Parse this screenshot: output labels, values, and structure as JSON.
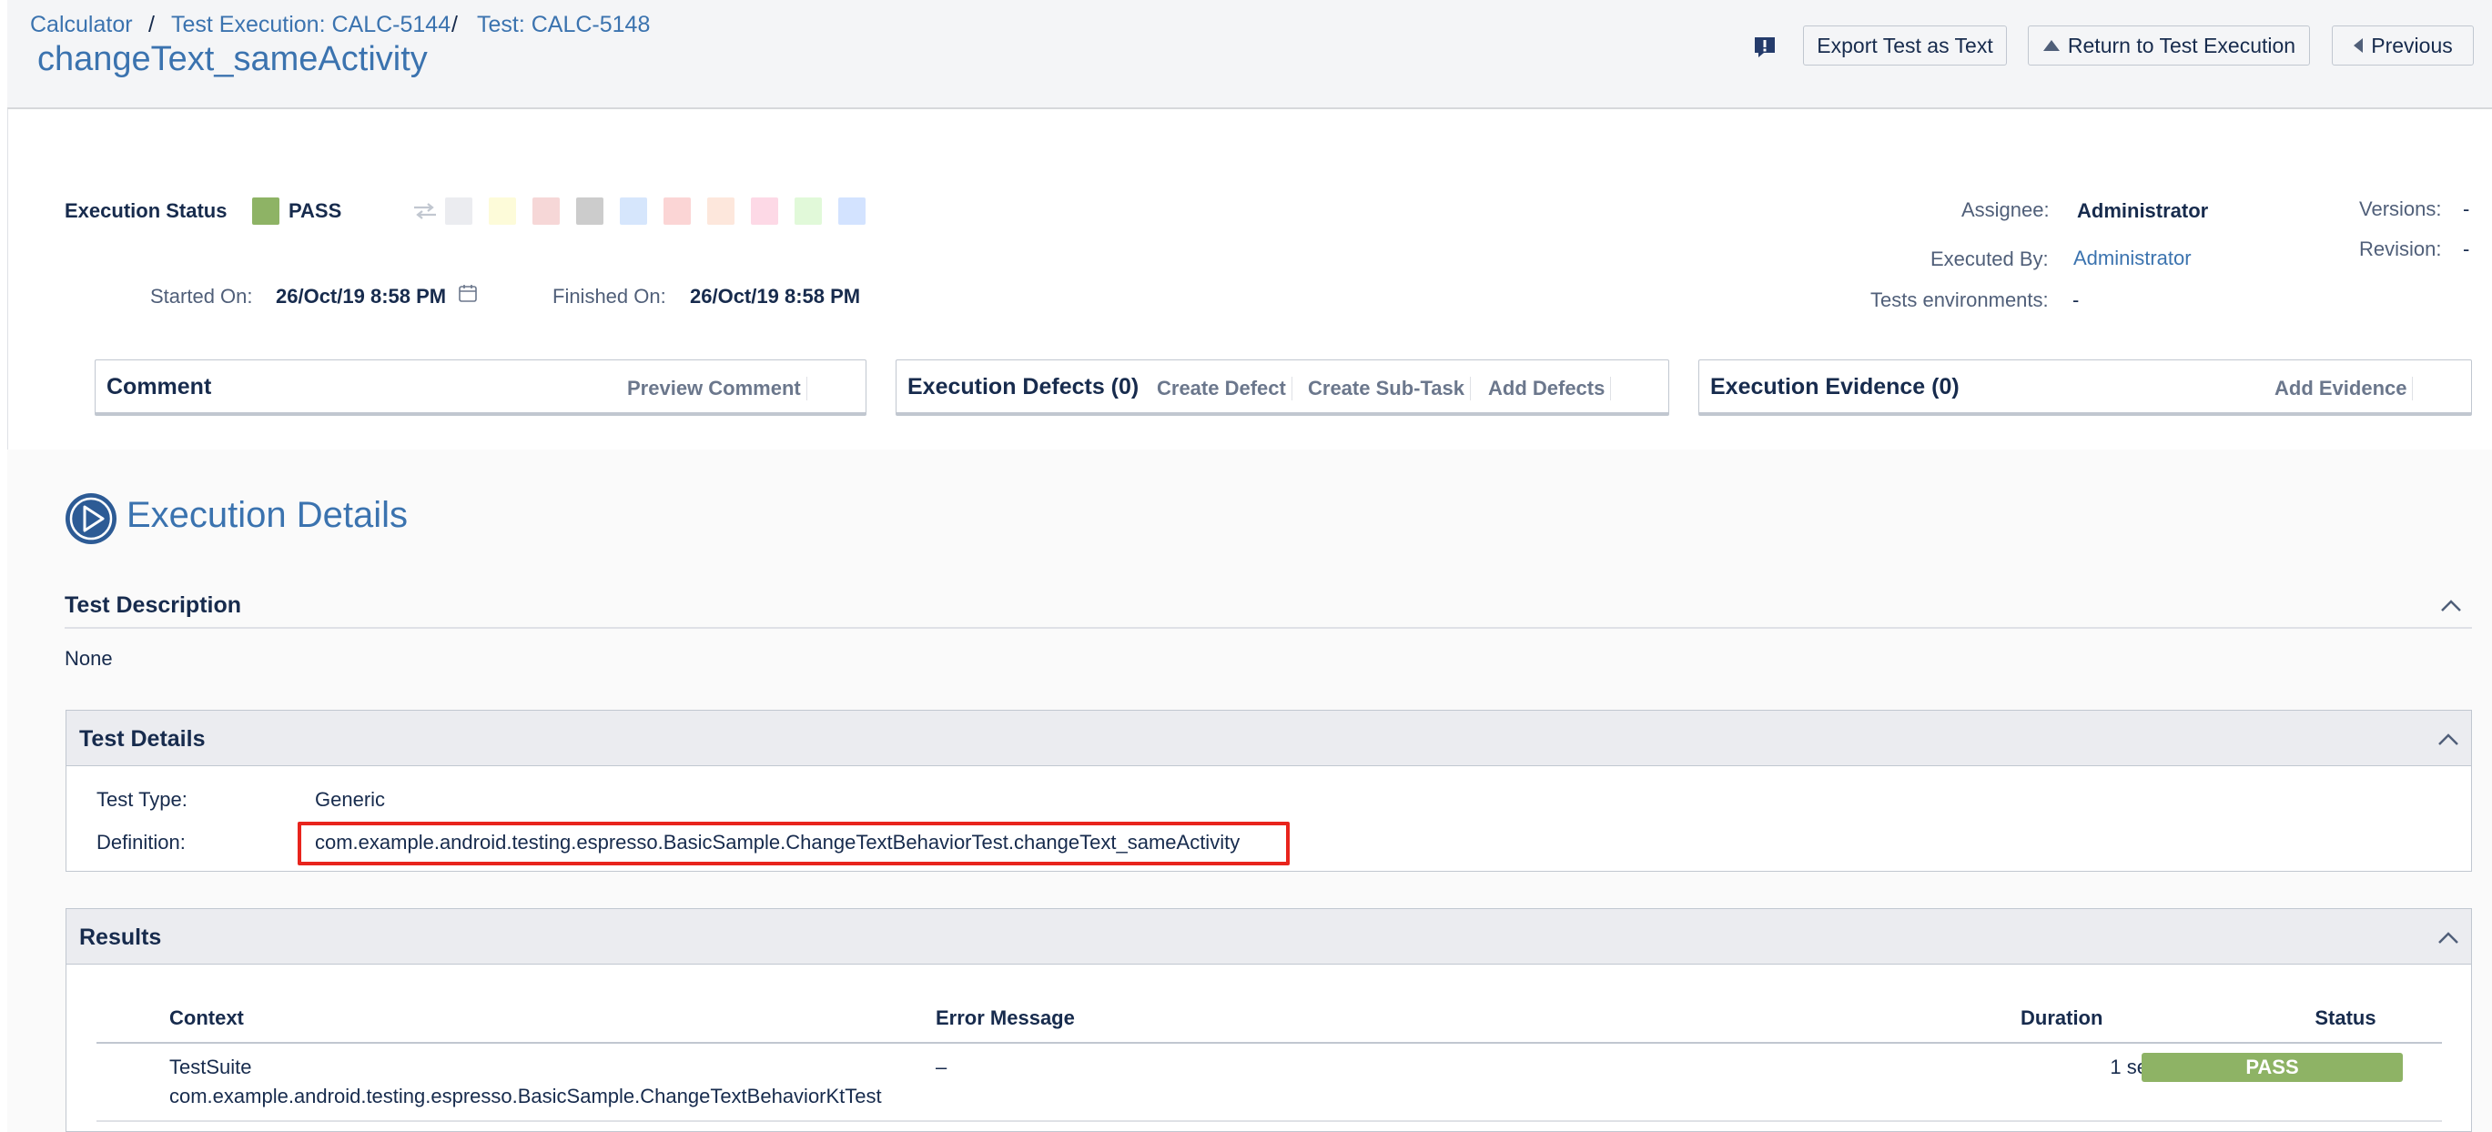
{
  "breadcrumb": [
    {
      "label": "Calculator"
    },
    {
      "label": "Test Execution: CALC-5144"
    },
    {
      "label": "Test: CALC-5148"
    }
  ],
  "breadcrumb_separator": "/",
  "page_title": "changeText_sameActivity",
  "header_buttons": {
    "export": "Export Test as Text",
    "return": "Return to Test Execution",
    "previous": "Previous"
  },
  "execution": {
    "status_label": "Execution Status",
    "status_value": "PASS",
    "status_color": "#8eb365",
    "status_swatches": [
      "#ebecf0",
      "#fdfbd9",
      "#f6d7d7",
      "#cccccc",
      "#d6e6fc",
      "#fbd5d5",
      "#fde7dc",
      "#fdd9e6",
      "#e1f9d9",
      "#d3e3ff"
    ],
    "started_label": "Started On:",
    "started_value": "26/Oct/19 8:58 PM",
    "finished_label": "Finished On:",
    "finished_value": "26/Oct/19 8:58 PM"
  },
  "people": {
    "assignee_label": "Assignee:",
    "assignee_value": "Administrator",
    "executed_by_label": "Executed By:",
    "executed_by_value": "Administrator",
    "environments_label": "Tests environments:",
    "environments_value": "-",
    "versions_label": "Versions:",
    "versions_value": "-",
    "revision_label": "Revision:",
    "revision_value": "-"
  },
  "panels": {
    "comment": {
      "title": "Comment",
      "action": "Preview Comment"
    },
    "defects": {
      "title": "Execution Defects (0)",
      "actions": [
        "Create Defect",
        "Create Sub-Task",
        "Add Defects"
      ]
    },
    "evidence": {
      "title": "Execution Evidence (0)",
      "action": "Add Evidence"
    }
  },
  "execution_details": {
    "heading": "Execution Details",
    "description": {
      "title": "Test Description",
      "value": "None"
    },
    "test_details": {
      "title": "Test Details",
      "type_label": "Test Type:",
      "type_value": "Generic",
      "definition_label": "Definition:",
      "definition_value": "com.example.android.testing.espresso.BasicSample.ChangeTextBehaviorTest.changeText_sameActivity",
      "highlight_color": "#e8241d"
    },
    "results": {
      "title": "Results",
      "columns": [
        "Context",
        "Error Message",
        "Duration",
        "Status"
      ],
      "rows": [
        {
          "context_line1": "TestSuite",
          "context_line2": "com.example.android.testing.espresso.BasicSample.ChangeTextBehaviorKtTest",
          "error": "–",
          "duration": "1 sec",
          "status": "PASS"
        }
      ]
    }
  }
}
